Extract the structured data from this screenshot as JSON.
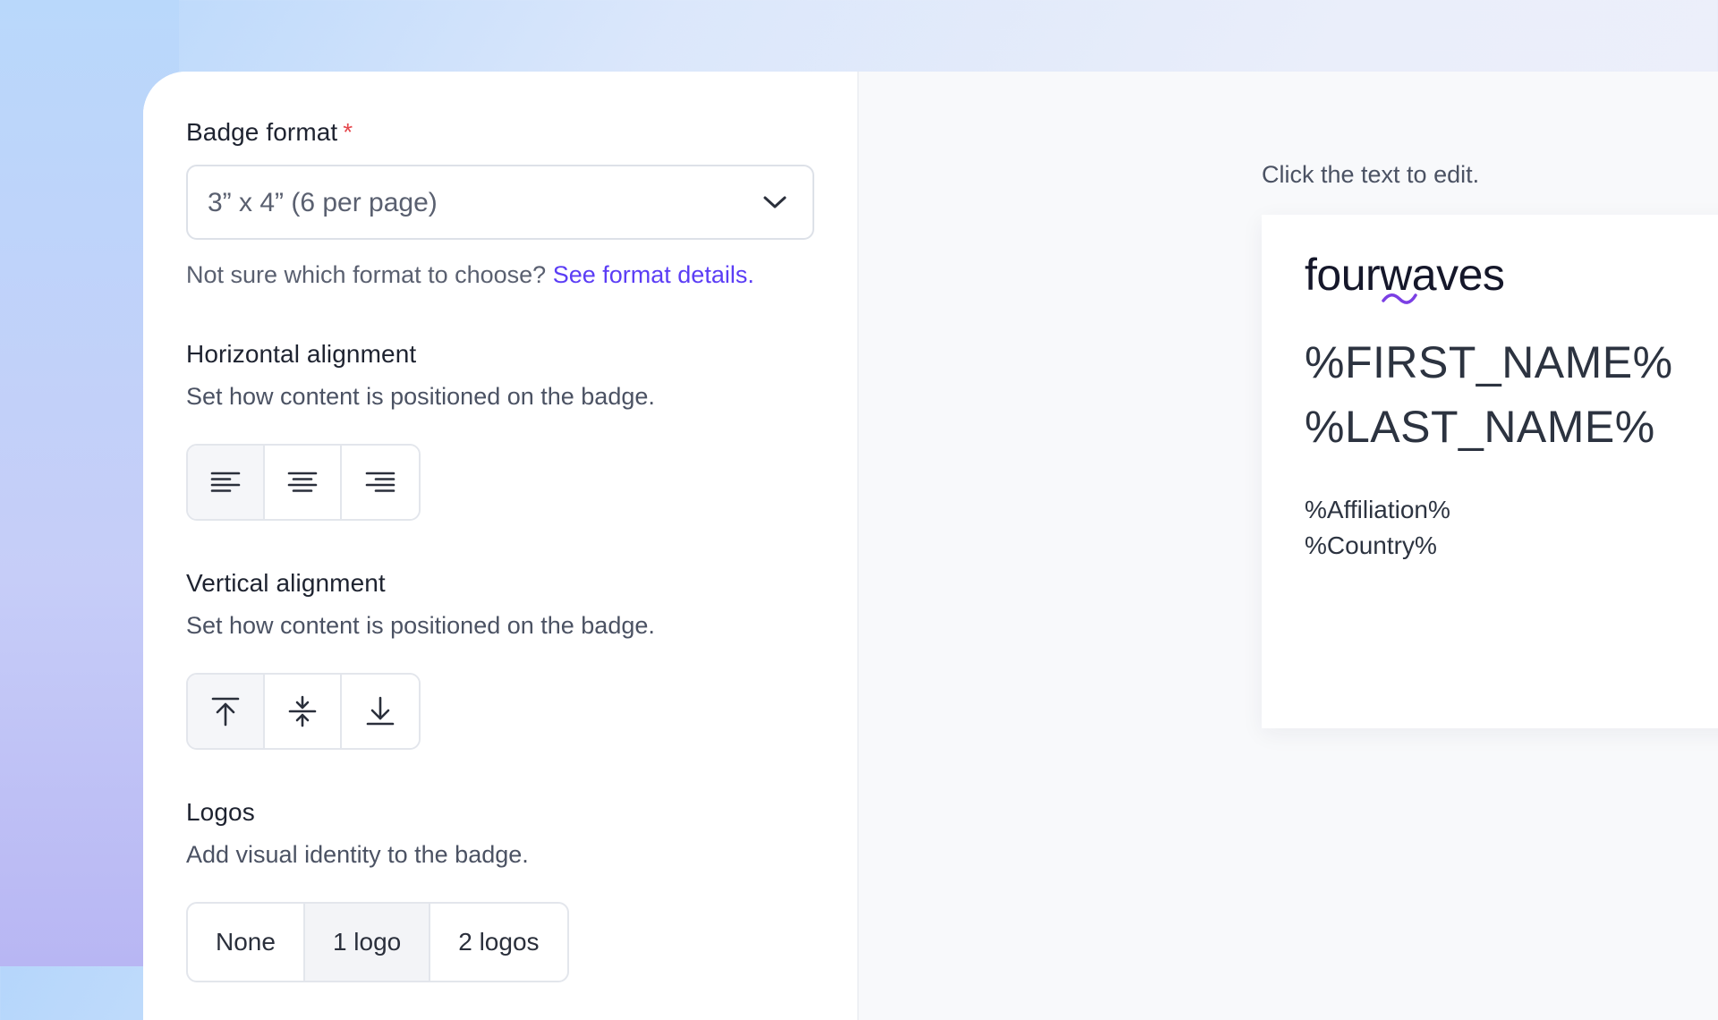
{
  "badge_format": {
    "label": "Badge format",
    "required_mark": "*",
    "selected": "3” x 4” (6 per page)",
    "helper_text": "Not sure which format to choose?",
    "helper_link": "See format details."
  },
  "horizontal_alignment": {
    "label": "Horizontal alignment",
    "description": "Set how content is positioned on the badge.",
    "options": [
      "align-left",
      "align-center",
      "align-right"
    ],
    "selected": "align-left"
  },
  "vertical_alignment": {
    "label": "Vertical alignment",
    "description": "Set how content is positioned on the badge.",
    "options": [
      "align-top",
      "align-middle",
      "align-bottom"
    ],
    "selected": "align-top"
  },
  "logos": {
    "label": "Logos",
    "description": "Add visual identity to the badge.",
    "options": [
      "None",
      "1 logo",
      "2 logos"
    ],
    "selected": "1 logo"
  },
  "preview": {
    "hint": "Click the text to edit.",
    "brand_before": "four",
    "brand_w": "w",
    "brand_after": "aves",
    "first_name": "%FIRST_NAME%",
    "last_name": "%LAST_NAME%",
    "affiliation": "%Affiliation%",
    "country": "%Country%"
  },
  "colors": {
    "link": "#5b3df5",
    "required": "#e5484d",
    "brand_accent": "#7b3fe4"
  }
}
